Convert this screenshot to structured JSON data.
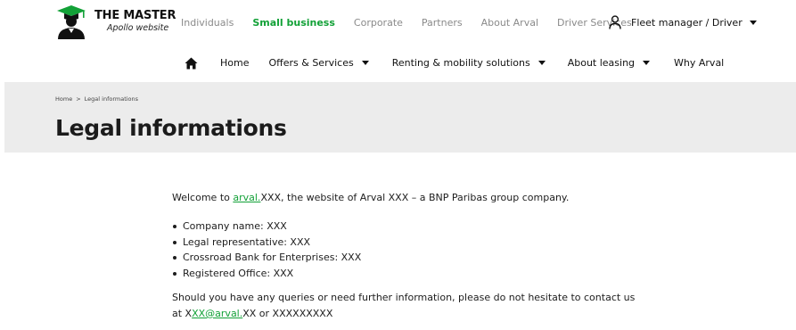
{
  "brand": {
    "title": "THE MASTER",
    "subtitle": "Apollo website",
    "icon": "graduate-logo-icon",
    "accent_color": "#12a137"
  },
  "segments": [
    {
      "label": "Individuals",
      "active": false
    },
    {
      "label": "Small business",
      "active": true
    },
    {
      "label": "Corporate",
      "active": false
    },
    {
      "label": "Partners",
      "active": false
    },
    {
      "label": "About Arval",
      "active": false
    },
    {
      "label": "Driver Services",
      "active": false
    }
  ],
  "user_menu": {
    "label": "Fleet manager / Driver",
    "icon": "user-icon"
  },
  "main_nav": {
    "home_icon": "home-icon",
    "items": [
      {
        "label": "Home",
        "has_dropdown": false
      },
      {
        "label": "Offers & Services",
        "has_dropdown": true
      },
      {
        "label": "Renting & mobility solutions",
        "has_dropdown": true
      },
      {
        "label": "About leasing",
        "has_dropdown": true
      },
      {
        "label": "Why Arval",
        "has_dropdown": false
      }
    ]
  },
  "breadcrumb": {
    "home": "Home",
    "separator": ">",
    "current": "Legal informations"
  },
  "page_title": "Legal informations",
  "content": {
    "intro_before": "Welcome to ",
    "intro_link": "arval.",
    "intro_after": "XXX, the website of Arval XXX – a BNP Paribas group company.",
    "items": [
      "Company name: XXX",
      "Legal representative: XXX",
      "Crossroad Bank for Enterprises: XXX",
      "Registered Office: XXX"
    ],
    "contact_line1": "Should you have any queries or need further information, please do not hesitate to contact us",
    "contact_at": "at X",
    "contact_email_link": "XX@arval.",
    "contact_after": "XX or XXXXXXXXX"
  }
}
